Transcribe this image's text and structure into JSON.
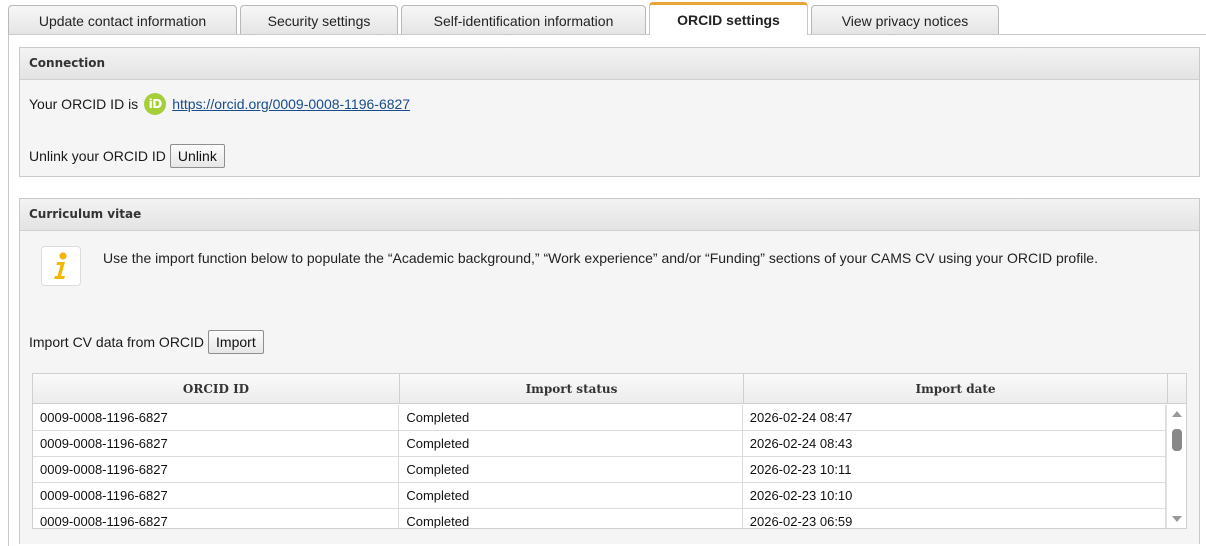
{
  "tabs": [
    {
      "label": "Update contact information",
      "active": false
    },
    {
      "label": "Security settings",
      "active": false
    },
    {
      "label": "Self-identification information",
      "active": false
    },
    {
      "label": "ORCID settings",
      "active": true
    },
    {
      "label": "View privacy notices",
      "active": false
    }
  ],
  "connection": {
    "header": "Connection",
    "id_prefix": "Your ORCID ID is",
    "orcid_logo_text": "iD",
    "orcid_url": "https://orcid.org/0009-0008-1196-6827",
    "unlink_label": "Unlink your ORCID ID",
    "unlink_button": "Unlink"
  },
  "cv": {
    "header": "Curriculum vitae",
    "info_icon": "info-icon",
    "info_text": "Use the import function below to populate the “Academic background,” “Work experience” and/or “Funding” sections of your CAMS CV using your ORCID profile.",
    "import_label": "Import CV data from ORCID",
    "import_button": "Import",
    "table": {
      "columns": [
        "ORCID ID",
        "Import status",
        "Import date"
      ],
      "rows": [
        [
          "0009-0008-1196-6827",
          "Completed",
          "2026-02-24 08:47"
        ],
        [
          "0009-0008-1196-6827",
          "Completed",
          "2026-02-24 08:43"
        ],
        [
          "0009-0008-1196-6827",
          "Completed",
          "2026-02-23 10:11"
        ],
        [
          "0009-0008-1196-6827",
          "Completed",
          "2026-02-23 10:10"
        ],
        [
          "0009-0008-1196-6827",
          "Completed",
          "2026-02-23 06:59"
        ]
      ]
    }
  },
  "colors": {
    "active_tab_accent": "#e8a33a",
    "orcid_green": "#a6ce39",
    "info_icon_yellow": "#f2b705",
    "link": "#1a4b8c"
  }
}
